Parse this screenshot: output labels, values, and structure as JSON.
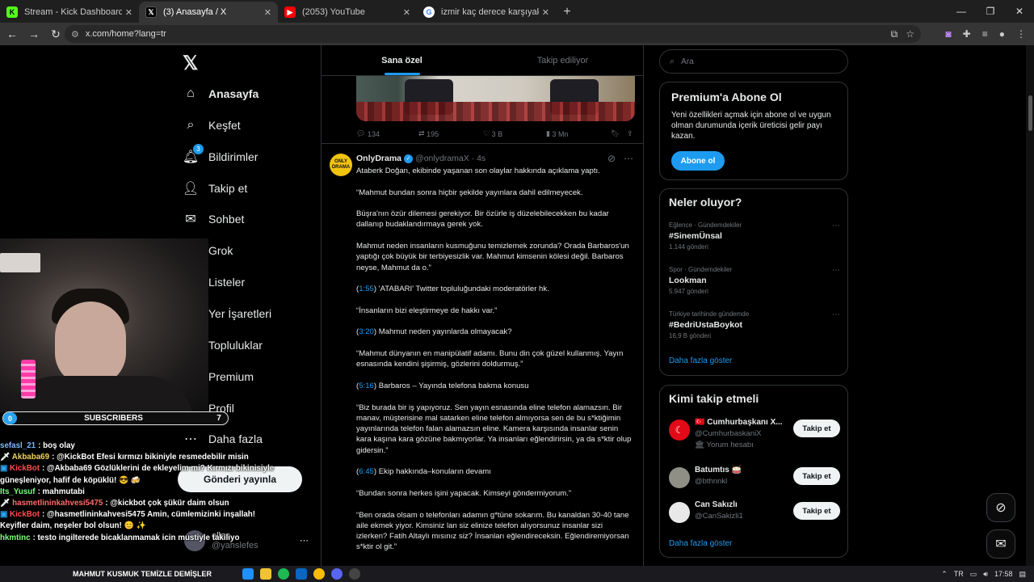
{
  "browser": {
    "tabs": [
      {
        "title": "Stream - Kick Dashboard",
        "active": false
      },
      {
        "title": "(3) Anasayfa / X",
        "active": true
      },
      {
        "title": "(2053) YouTube",
        "active": false
      },
      {
        "title": "izmir kaç derece karşıyaka - Go",
        "active": false
      }
    ],
    "url": "x.com/home?lang=tr"
  },
  "nav": {
    "items": [
      {
        "label": "Anasayfa",
        "icon": "home-icon"
      },
      {
        "label": "Keşfet",
        "icon": "search-icon"
      },
      {
        "label": "Bildirimler",
        "icon": "bell-icon",
        "badge": "3"
      },
      {
        "label": "Takip et",
        "icon": "add-user-icon"
      },
      {
        "label": "Sohbet",
        "icon": "mail-icon"
      },
      {
        "label": "Grok",
        "icon": "grok-icon"
      },
      {
        "label": "Listeler",
        "icon": "list-icon"
      },
      {
        "label": "Yer İşaretleri",
        "icon": "bookmark-icon"
      },
      {
        "label": "Topluluklar",
        "icon": "communities-icon"
      },
      {
        "label": "Premium",
        "icon": "x-premium-icon"
      },
      {
        "label": "Profil",
        "icon": "profile-icon"
      },
      {
        "label": "Daha fazla",
        "icon": "more-icon"
      }
    ],
    "post_button": "Gönderi yayınla",
    "profile_handle": "@yahslefes",
    "profile_name": "elles"
  },
  "timeline": {
    "tabs": [
      "Sana özel",
      "Takip ediliyor"
    ],
    "prev_post": {
      "replies": "134",
      "reposts": "195",
      "likes": "3 B",
      "views": "3 Mn"
    },
    "post": {
      "name": "OnlyDrama",
      "handle": "@onlydramaX",
      "time": "4s",
      "avatar_text": "ONLY DRAMA",
      "paragraphs": [
        {
          "text": "Ataberk Doğan, ekibinde yaşanan son olaylar hakkında açıklama yaptı."
        },
        {
          "text": "“Mahmut bundan sonra hiçbir şekilde yayınlara dahil edilmeyecek."
        },
        {
          "text": "Büşra'nın özür dilemesi gerekiyor. Bir özürle iş düzelebilecekken bu kadar dallanıp budaklandırmaya gerek yok."
        },
        {
          "text": "Mahmut neden insanların kusmuğunu temizlemek zorunda? Orada Barbaros'un yaptığı çok büyük bir terbiyesizlik var. Mahmut kimsenin kölesi değil. Barbaros neyse, Mahmut da o.”"
        },
        {
          "link": "1:55",
          "text": " 'ATABARI' Twitter topluluğundaki moderatörler hk."
        },
        {
          "text": "“İnsanların bizi eleştirmeye de hakkı var.”"
        },
        {
          "link": "3:20",
          "text": " Mahmut neden yayınlarda olmayacak?"
        },
        {
          "text": "“Mahmut dünyanın en manipülatif adamı. Bunu din çok güzel kullanmış. Yayın esnasında kendini şişirmiş, gözlerini doldurmuş.”"
        },
        {
          "link": "5:16",
          "text": " Barbaros – Yayında telefona bakma konusu"
        },
        {
          "text": "“Biz burada bir iş yapıyoruz. Sen yayın esnasında eline telefon alamazsın. Bir manav, müşterisine mal satarken eline telefon almıyorsa sen de bu s*ktiğimin yayınlarında telefon falan alamazsın eline. Kamera karşısında insanlar senin kara kaşına kara gözüne bakmıyorlar. Ya insanları eğlendirirsin, ya da s*ktir olup gidersin.”"
        },
        {
          "link": "6:45",
          "text": " Ekip hakkında–konuların devamı"
        },
        {
          "text": "“Bundan sonra herkes işini yapacak. Kimseyi göndermiyorum.”"
        },
        {
          "text": "“Ben orada olsam o telefonları adamın g*tüne sokarım. Bu kanaldan 30-40 tane aile ekmek yiyor. Kimsiniz lan siz elinize telefon alıyorsunuz insanlar sizi izlerken? Fatih Altaylı mısınız siz? İnsanları eğlendireceksin. Eğlendiremiyorsan s*ktir ol git.”"
        }
      ]
    }
  },
  "sidebar": {
    "search_placeholder": "Ara",
    "premium": {
      "title": "Premium'a Abone Ol",
      "text": "Yeni özellikleri açmak için abone ol ve uygun olman durumunda içerik üreticisi gelir payı kazan.",
      "button": "Abone ol"
    },
    "trends": {
      "title": "Neler oluyor?",
      "items": [
        {
          "category": "Eğlence · Gündemdekiler",
          "tag": "#SinemÜnsal",
          "count": "1.144 gönderi"
        },
        {
          "category": "Spor · Gündemdekiler",
          "tag": "Lookman",
          "count": "5.947 gönderi"
        },
        {
          "category": "Türkiye tarihinde gündemde",
          "tag": "#BedriUstaBoykot",
          "count": "16,9 B gönderi"
        }
      ],
      "show_more": "Daha fazla göster"
    },
    "who_to_follow": {
      "title": "Kimi takip etmeli",
      "accounts": [
        {
          "name": "🇹🇷 Cumhurbaşkanı X...",
          "handle": "@CumhurbaskaniX",
          "extra": "🏛 Yorum hesabı",
          "button": "Takip et"
        },
        {
          "name": "Batumtıs 🥁",
          "handle": "@bthnnkl",
          "button": "Takip et"
        },
        {
          "name": "Can Sakızlı",
          "handle": "@CanSakizli1",
          "button": "Takip et"
        }
      ],
      "show_more": "Daha fazla göster"
    }
  },
  "overlay": {
    "sub_left": "0",
    "sub_label": "SUBSCRIBERS",
    "sub_right": "7",
    "chat": [
      {
        "user": "sefasl_21",
        "color": "#7fb7ff",
        "msg": ": boş olay"
      },
      {
        "user": "Akbaba69",
        "color": "#f2d35b",
        "msg": ": @KickBot Efesi kırmızı bikiniyle resmedebilir misin"
      },
      {
        "user": "KickBot",
        "color": "#ff4d4d",
        "msg": ": @Akbaba69 Gözlüklerini de ekleyelim mi? Kırmızı bikinisiyle güneşleniyor, hafif de köpüklü! 😎 🍻"
      },
      {
        "user": "Its_Yusuf",
        "color": "#7dff7d",
        "msg": ": mahmutabi"
      },
      {
        "user": "hasmetlininkahvesi5475",
        "color": "#ff6b6b",
        "msg": ": @kickbot çok şükür daim olsun"
      },
      {
        "user": "KickBot",
        "color": "#ff4d4d",
        "msg": ": @hasmetlininkahvesi5475 Amin, cümlemizinki inşallah! Keyifler daim, neşeler bol olsun! 😊 ✨"
      },
      {
        "user": "hkmtinc",
        "color": "#7dff7d",
        "msg": ": testo ingilterede bicaklanmamak icin mustiyle takiliyo"
      }
    ]
  },
  "taskbar": {
    "ticker": "MAHMUT KUSMUK TEMİZLE DEMİŞLER",
    "time": "17:58",
    "lang": "TR"
  },
  "colors": {
    "accent": "#1d9bf0",
    "background": "#000000",
    "border": "#2f3336",
    "muted": "#71767b"
  }
}
